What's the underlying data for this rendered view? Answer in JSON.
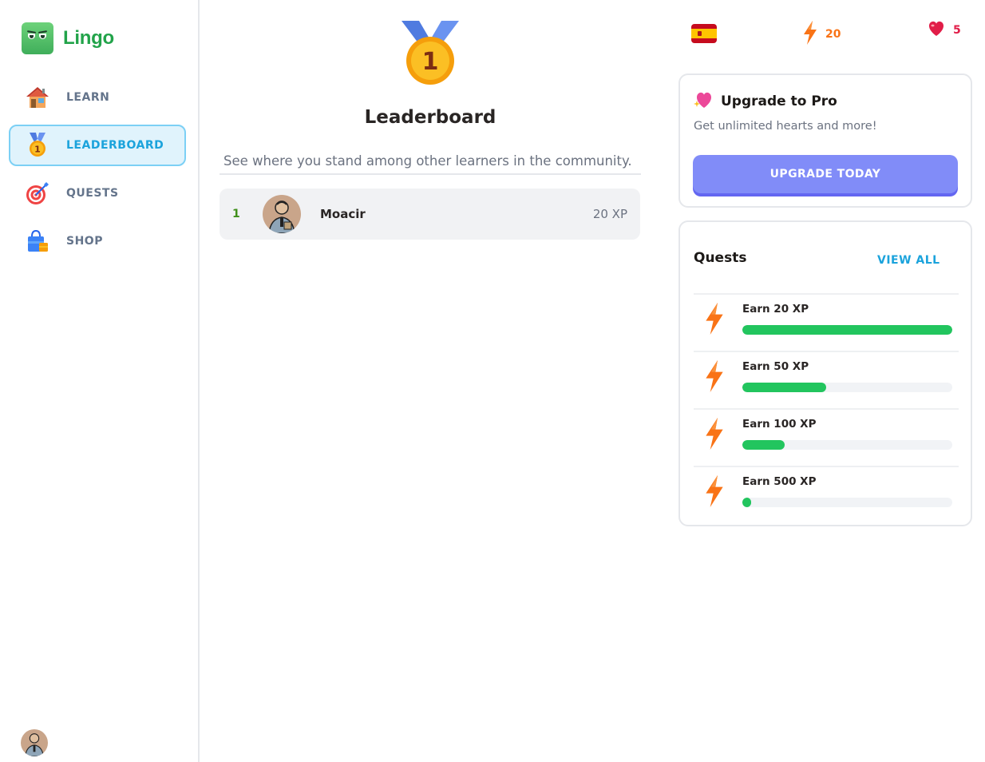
{
  "app": {
    "name": "Lingo"
  },
  "sidebar": {
    "items": [
      {
        "label": "LEARN",
        "icon": "house-icon",
        "active": false
      },
      {
        "label": "LEADERBOARD",
        "icon": "medal-icon",
        "active": true
      },
      {
        "label": "QUESTS",
        "icon": "target-icon",
        "active": false
      },
      {
        "label": "SHOP",
        "icon": "shopping-bag-icon",
        "active": false
      }
    ]
  },
  "main": {
    "title": "Leaderboard",
    "subtitle": "See where you stand among other learners in the community.",
    "medal_number": "1",
    "leaderboard": [
      {
        "rank": "1",
        "name": "Moacir",
        "xp": "20 XP"
      }
    ]
  },
  "stats": {
    "language_flag": "spain-flag-icon",
    "xp": "20",
    "hearts": "5",
    "xp_color": "#f97316",
    "hearts_color": "#e11d48"
  },
  "upgrade": {
    "title": "Upgrade to Pro",
    "subtitle": "Get unlimited hearts and more!",
    "button": "UPGRADE TODAY"
  },
  "quests": {
    "title": "Quests",
    "view_all": "VIEW ALL",
    "items": [
      {
        "label": "Earn 20 XP",
        "progress": 1.0
      },
      {
        "label": "Earn 50 XP",
        "progress": 0.4
      },
      {
        "label": "Earn 100 XP",
        "progress": 0.2
      },
      {
        "label": "Earn 500 XP",
        "progress": 0.04
      }
    ]
  },
  "colors": {
    "brand": "#22a34a",
    "accent": "#1ba3dc",
    "progress": "#22c55e",
    "pro_button": "#818cf8"
  }
}
